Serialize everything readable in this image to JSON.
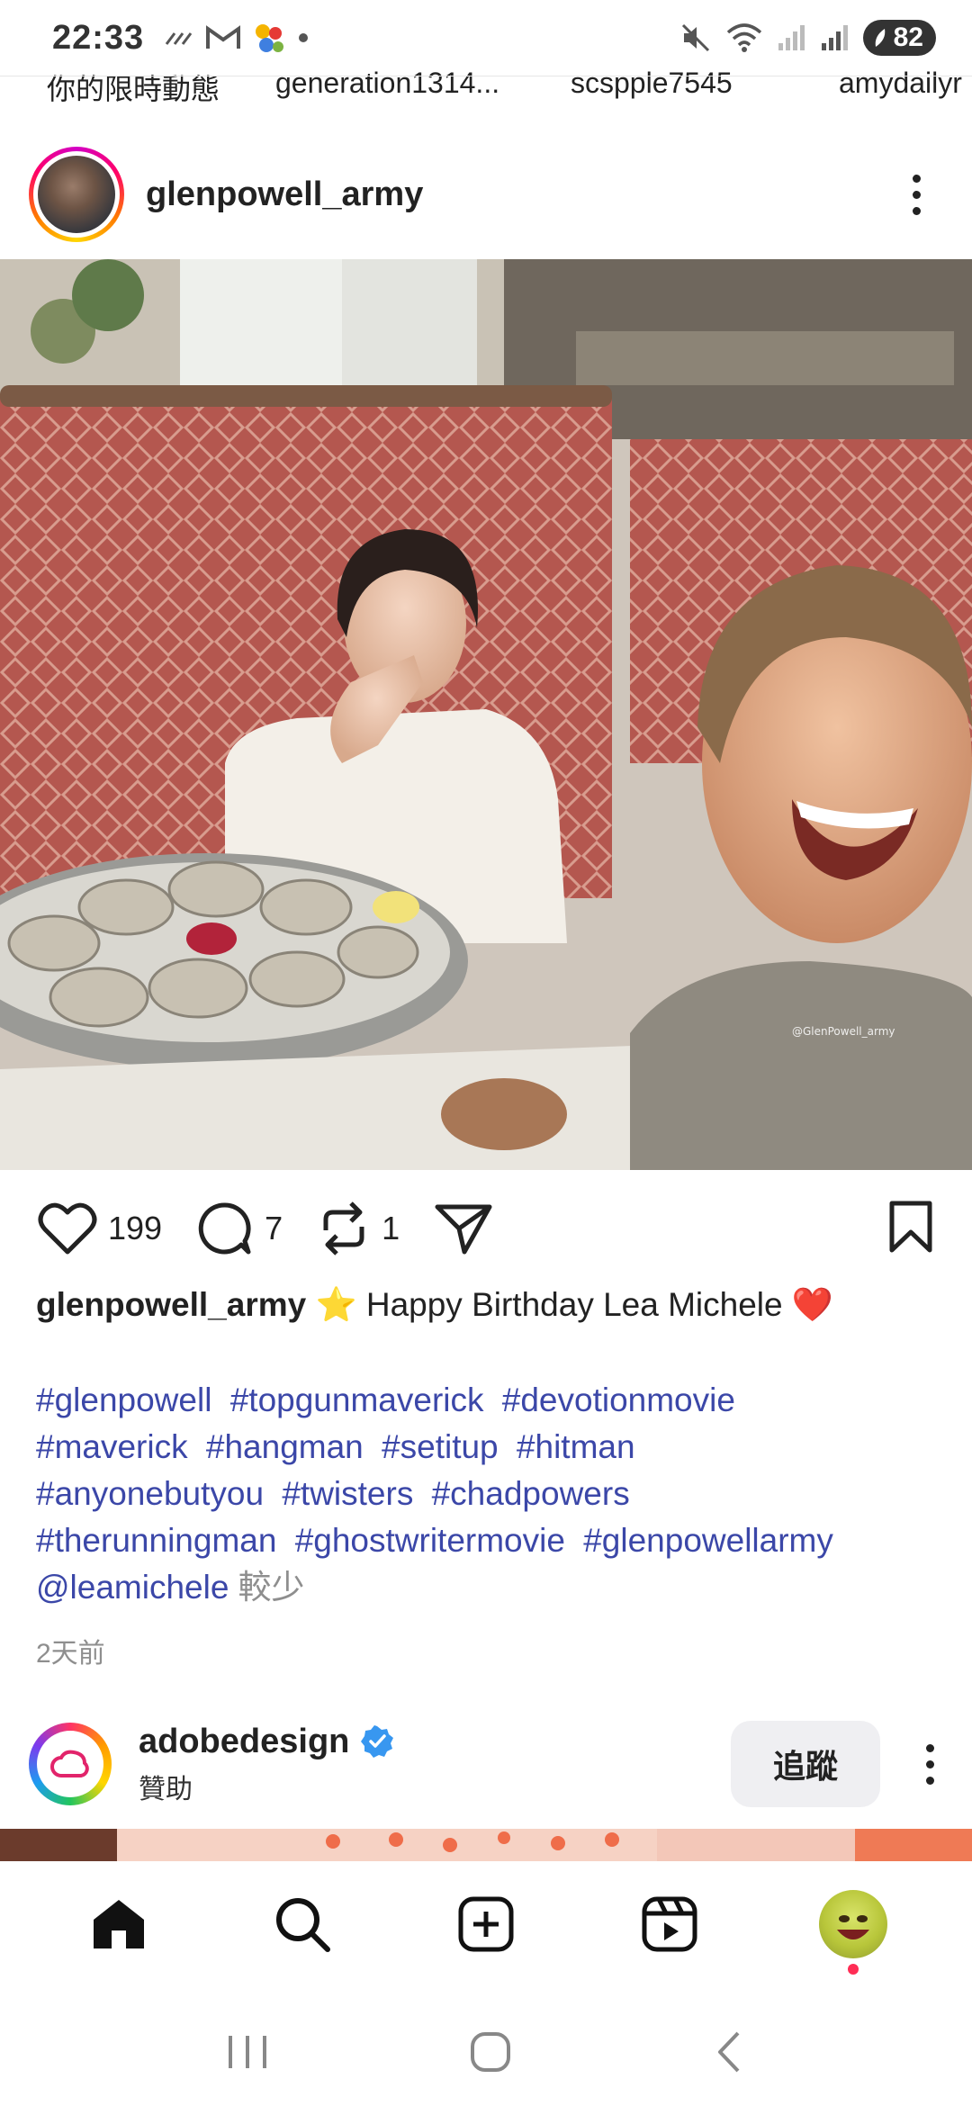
{
  "status_bar": {
    "time": "22:33",
    "battery": "82"
  },
  "stories": [
    "你的限時動態",
    "generation1314...",
    "scspple7545",
    "amydailyr"
  ],
  "post": {
    "username": "glenpowell_army",
    "likes": "199",
    "comments": "7",
    "reposts": "1",
    "caption_user": "glenpowell_army",
    "caption_text": "⭐ Happy Birthday Lea Michele ❤️",
    "hashtags": [
      "#glenpowell",
      "#topgunmaverick",
      "#devotionmovie",
      "#maverick",
      "#hangman",
      "#setitup",
      "#hitman",
      "#anyonebutyou",
      "#twisters",
      "#chadpowers",
      "#therunningman",
      "#ghostwritermovie",
      "#glenpowellarmy"
    ],
    "mention": "@leamichele",
    "less_label": "較少",
    "timestamp": "2天前",
    "watermark": "@GlenPowell_army"
  },
  "sponsored": {
    "name": "adobedesign",
    "subtitle": "贊助",
    "follow_label": "追蹤"
  },
  "colors": {
    "hashtag": "#3b47a8",
    "verified": "#3897f0",
    "notification_dot": "#ff2d55"
  }
}
